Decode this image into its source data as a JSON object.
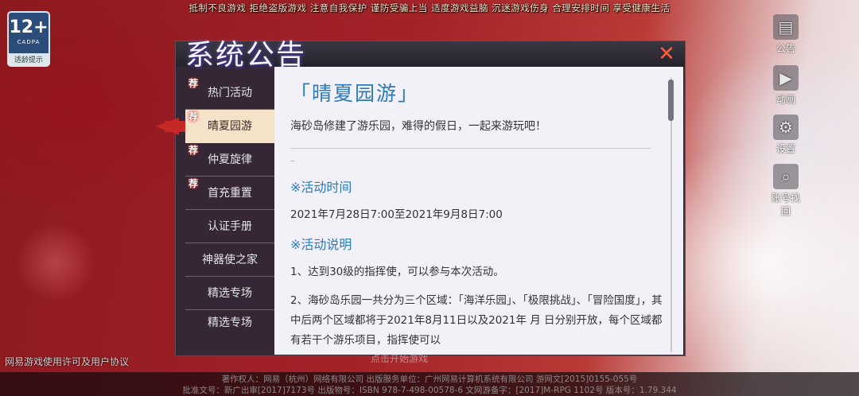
{
  "top_notice": "抵制不良游戏  拒绝盗版游戏  注意自我保护  谨防受骗上当  适度游戏益脑  沉迷游戏伤身  合理安排时间  享受健康生活",
  "age_badge": {
    "age": "12+",
    "org": "CADPA",
    "tip": "适龄提示"
  },
  "right_menu": [
    {
      "label": "公告",
      "icon": "notice-icon"
    },
    {
      "label": "动画",
      "icon": "video-icon"
    },
    {
      "label": "设置",
      "icon": "gear-icon"
    },
    {
      "label": "账号找回",
      "icon": "search-icon"
    }
  ],
  "panel": {
    "title": "系统公告",
    "close_label": "✕",
    "sidebar": [
      {
        "label": "热门活动",
        "tag": "荐",
        "active": false
      },
      {
        "label": "晴夏园游",
        "tag": "荐",
        "active": true
      },
      {
        "label": "仲夏旋律",
        "tag": "荐",
        "active": false
      },
      {
        "label": "首充重置",
        "tag": "荐",
        "active": false
      },
      {
        "label": "认证手册",
        "tag": "",
        "active": false
      },
      {
        "label": "神器使之家",
        "tag": "",
        "active": false
      },
      {
        "label": "精选专场",
        "tag": "",
        "active": false
      },
      {
        "label": "精选专场",
        "tag": "",
        "active": false
      }
    ],
    "content": {
      "title": "「晴夏园游」",
      "intro": "海砂岛修建了游乐园，难得的假日，一起来游玩吧！",
      "dash": "–",
      "time_heading": "※活动时间",
      "time_value": "2021年7月28日7:00至2021年9月8日7:00",
      "desc_heading": "※活动说明",
      "desc_1": "1、达到30级的指挥使，可以参与本次活动。",
      "desc_2": "2、海砂岛乐园一共分为三个区域：「海洋乐园」、「极限挑战」、「冒险国度」，其中后两个区域都将于2021年8月11日以及2021年 月 日分别开放，每个区域都有若干个游乐项目，指挥使可以"
    }
  },
  "bottom_left": "网易游戏使用许可及用户协议",
  "click_hint": "点击开始游戏",
  "footer_line1": "著作权人：网易（杭州）网络有限公司   出版服务单位：广州网易计算机系统有限公司   游网文[2015]0155-055号",
  "footer_line2": "批准文号：新广出审[2017]7173号   出版物号：ISBN 978-7-498-00578-6   文网游备字：[2017]M-RPG 1102号   版本号：1.79.344"
}
